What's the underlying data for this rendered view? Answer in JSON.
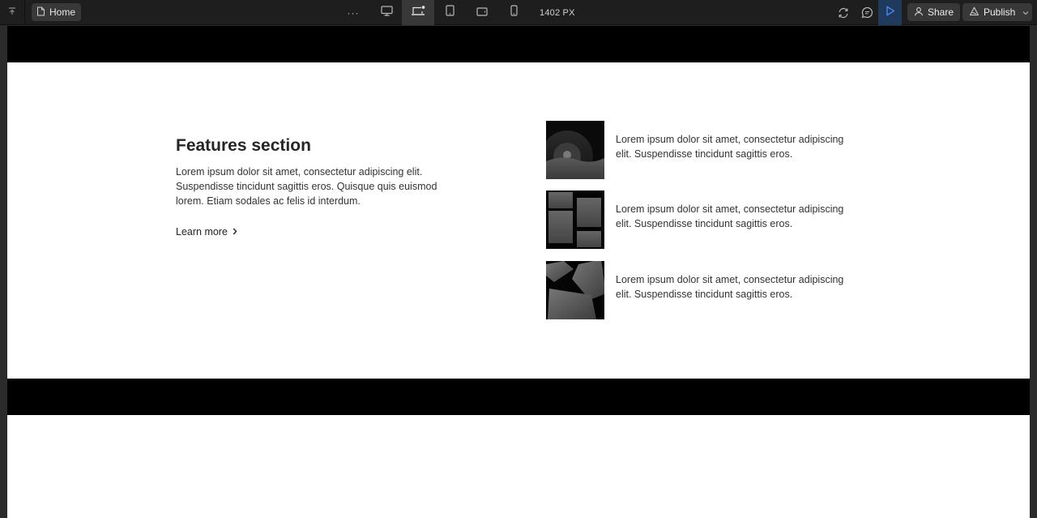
{
  "toolbar": {
    "page_name": "Home",
    "more_label": "···",
    "width_label": "1402 PX",
    "share_label": "Share",
    "publish_label": "Publish",
    "icons": [
      "collapse-icon",
      "page-icon",
      "desktop-icon",
      "laptop-icon",
      "tablet-icon",
      "tablet-landscape-icon",
      "mobile-icon",
      "sync-icon",
      "comment-icon",
      "play-icon",
      "user-icon",
      "publish-icon",
      "chevron-down-icon"
    ]
  },
  "features": {
    "title": "Features section",
    "description": "Lorem ipsum dolor sit amet, consectetur adipiscing elit. Suspendisse tincidunt sagittis eros. Quisque quis euismod lorem. Etiam sodales ac felis id interdum.",
    "link_label": "Learn more",
    "items": [
      {
        "text": "Lorem ipsum dolor sit amet, consectetur adipiscing elit. Suspendisse tincidunt sagittis eros."
      },
      {
        "text": "Lorem ipsum dolor sit amet, consectetur adipiscing elit. Suspendisse tincidunt sagittis eros."
      },
      {
        "text": "Lorem ipsum dolor sit amet, consectetur adipiscing elit. Suspendisse tincidunt sagittis eros."
      }
    ]
  },
  "colors": {
    "toolbar_bg": "#1e1e1e",
    "chip_bg": "#383838",
    "play_bg": "#1f3a5c",
    "accent_blue": "#4c8dff",
    "canvas_bg": "#ffffff",
    "bar_black": "#000000"
  }
}
